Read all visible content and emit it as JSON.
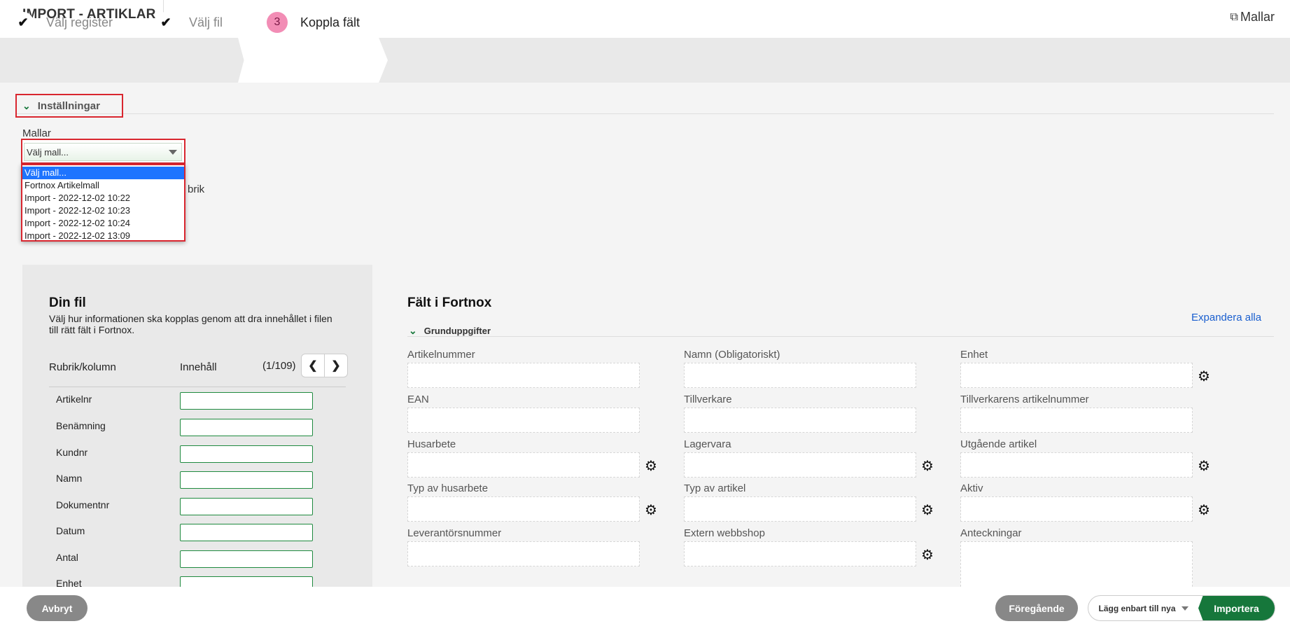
{
  "header": {
    "title": "IMPORT - ARTIKLAR",
    "templates_link": "Mallar",
    "templates_icon": "copy-icon"
  },
  "stepper": {
    "steps": [
      {
        "label": "Välj register",
        "state": "done"
      },
      {
        "label": "Välj fil",
        "state": "done"
      },
      {
        "label": "Koppla fält",
        "state": "active",
        "number": "3"
      }
    ]
  },
  "settings": {
    "heading": "Inställningar",
    "templates_label": "Mallar",
    "select_value": "Välj mall...",
    "options": [
      "Välj mall...",
      "Fortnox Artikelmall",
      "Import - 2022-12-02 10:22",
      "Import - 2022-12-02 10:23",
      "Import - 2022-12-02 10:24",
      "Import - 2022-12-02 13:09"
    ],
    "partially_hidden_text": "brik"
  },
  "your_file": {
    "title": "Din fil",
    "description": "Välj hur informationen ska kopplas genom att dra innehållet i filen till rätt fält i Fortnox.",
    "col_header": "Rubrik/kolumn",
    "content_header": "Innehåll",
    "page_count": "(1/109)",
    "rows": [
      "Artikelnr",
      "Benämning",
      "Kundnr",
      "Namn",
      "Dokumentnr",
      "Datum",
      "Antal",
      "Enhet"
    ]
  },
  "fortnox_fields": {
    "title": "Fält i Fortnox",
    "expand_all": "Expandera alla",
    "group": "Grunduppgifter",
    "fields": [
      {
        "label": "Artikelnummer",
        "gear": false
      },
      {
        "label": "Namn (Obligatoriskt)",
        "gear": false
      },
      {
        "label": "Enhet",
        "gear": true
      },
      {
        "label": "EAN",
        "gear": false
      },
      {
        "label": "Tillverkare",
        "gear": false
      },
      {
        "label": "Tillverkarens artikelnummer",
        "gear": false
      },
      {
        "label": "Husarbete",
        "gear": true
      },
      {
        "label": "Lagervara",
        "gear": true
      },
      {
        "label": "Utgående artikel",
        "gear": true
      },
      {
        "label": "Typ av husarbete",
        "gear": true
      },
      {
        "label": "Typ av artikel",
        "gear": true
      },
      {
        "label": "Aktiv",
        "gear": true
      },
      {
        "label": "Leverantörsnummer",
        "gear": false
      },
      {
        "label": "Extern webbshop",
        "gear": true
      },
      {
        "label": "Anteckningar",
        "gear": false
      }
    ]
  },
  "footer": {
    "cancel": "Avbryt",
    "previous": "Föregående",
    "mode": "Lägg enbart till nya",
    "import": "Importera"
  }
}
